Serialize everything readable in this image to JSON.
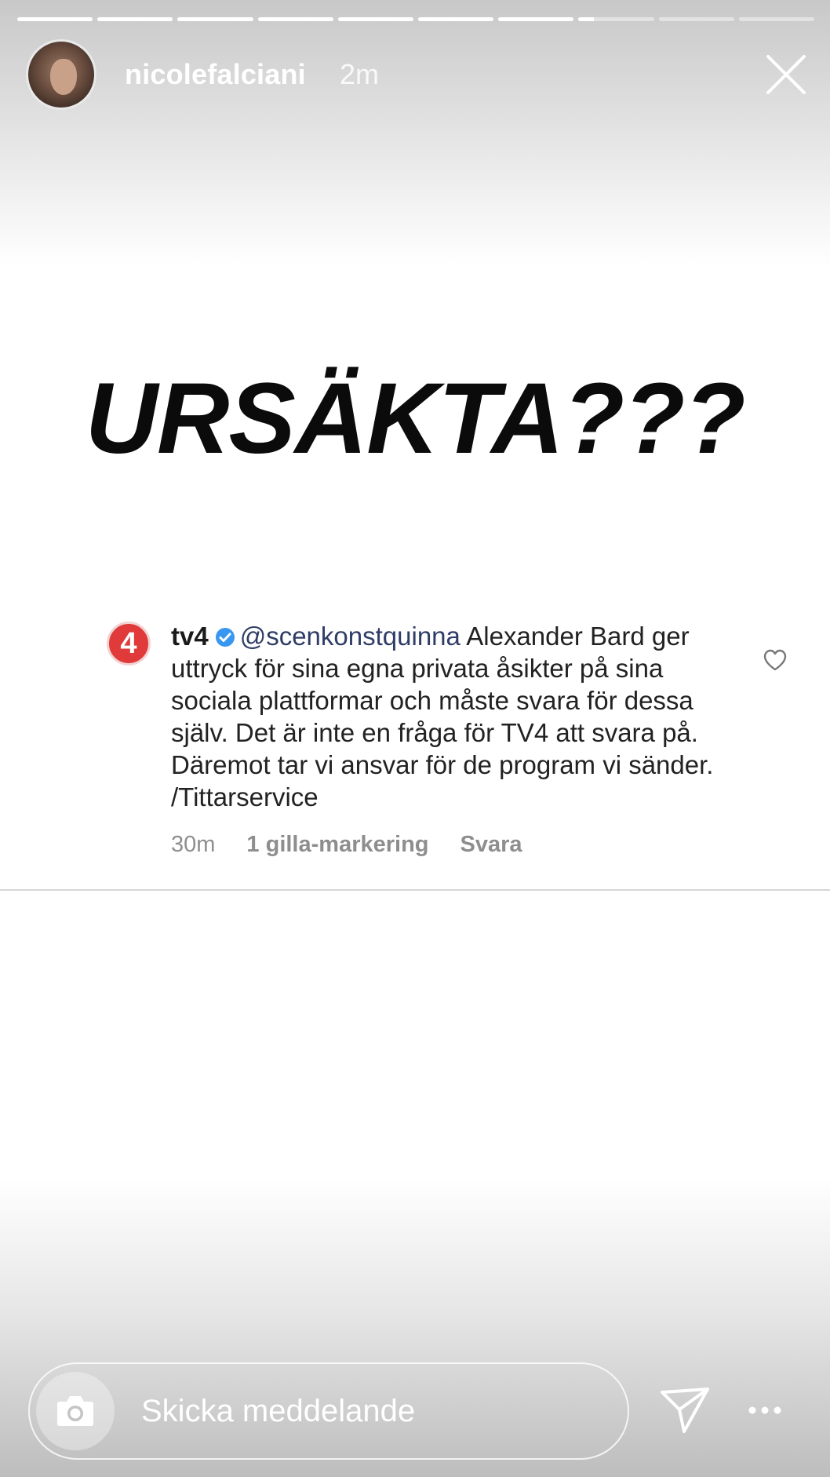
{
  "story": {
    "username": "nicolefalciani",
    "time": "2m",
    "progress_segments": [
      1,
      1,
      1,
      1,
      1,
      1,
      1,
      0.2,
      0,
      0
    ],
    "headline": "URSÄKTA???"
  },
  "comment": {
    "author": "tv4",
    "logo_text": "4",
    "mention": "@scenkonstquinna",
    "text": "Alexander Bard ger uttryck för sina egna privata åsikter på sina sociala plattformar och måste svara för dessa själv. Det är inte en fråga för TV4 att svara på. Däremot tar vi ansvar för de program vi sänder. /Tittarservice",
    "time_ago": "30m",
    "likes": "1 gilla-markering",
    "reply_label": "Svara"
  },
  "composer": {
    "placeholder": "Skicka meddelande"
  },
  "colors": {
    "logo_red": "#e03a3a",
    "verified_blue": "#3897f0",
    "mention": "#2f3d66"
  },
  "icons": [
    "close-icon",
    "verified-icon",
    "heart-icon",
    "camera-icon",
    "send-icon",
    "more-icon"
  ]
}
